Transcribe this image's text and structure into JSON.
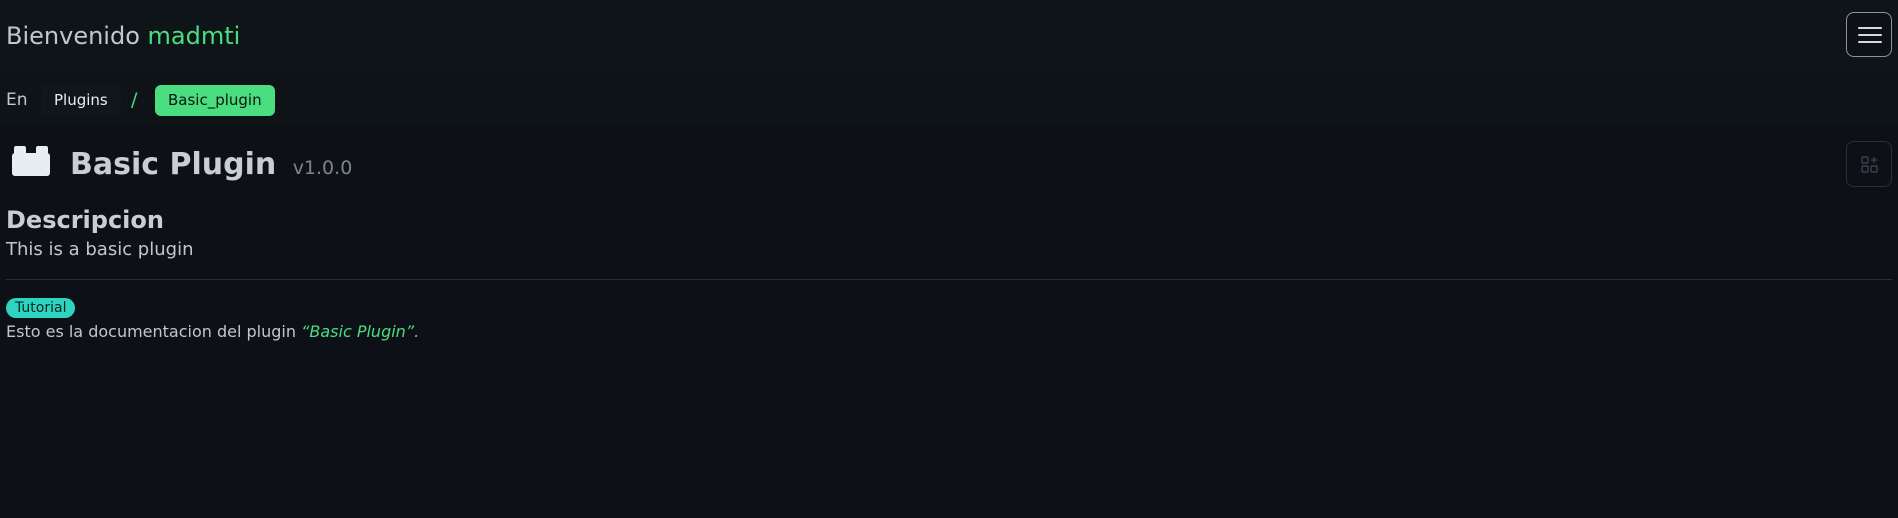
{
  "header": {
    "greeting": "Bienvenido",
    "username": "madmti",
    "menu_icon": "hamburger-menu-icon"
  },
  "breadcrumb": {
    "language": "En",
    "items": [
      "Plugins",
      "Basic_plugin"
    ],
    "separator": "/"
  },
  "plugin": {
    "icon": "plugin-block-icon",
    "title": "Basic Plugin",
    "version": "v1.0.0",
    "action_icon": "add-widget-icon"
  },
  "description": {
    "heading": "Descripcion",
    "text": "This is a basic plugin"
  },
  "docs": {
    "tag": "Tutorial",
    "text": "Esto es la documentacion del plugin",
    "highlight": "“Basic Plugin”",
    "suffix": "."
  },
  "colors": {
    "background": "#0d1117",
    "accent": "#4ade80",
    "tag": "#2dd4bf"
  }
}
